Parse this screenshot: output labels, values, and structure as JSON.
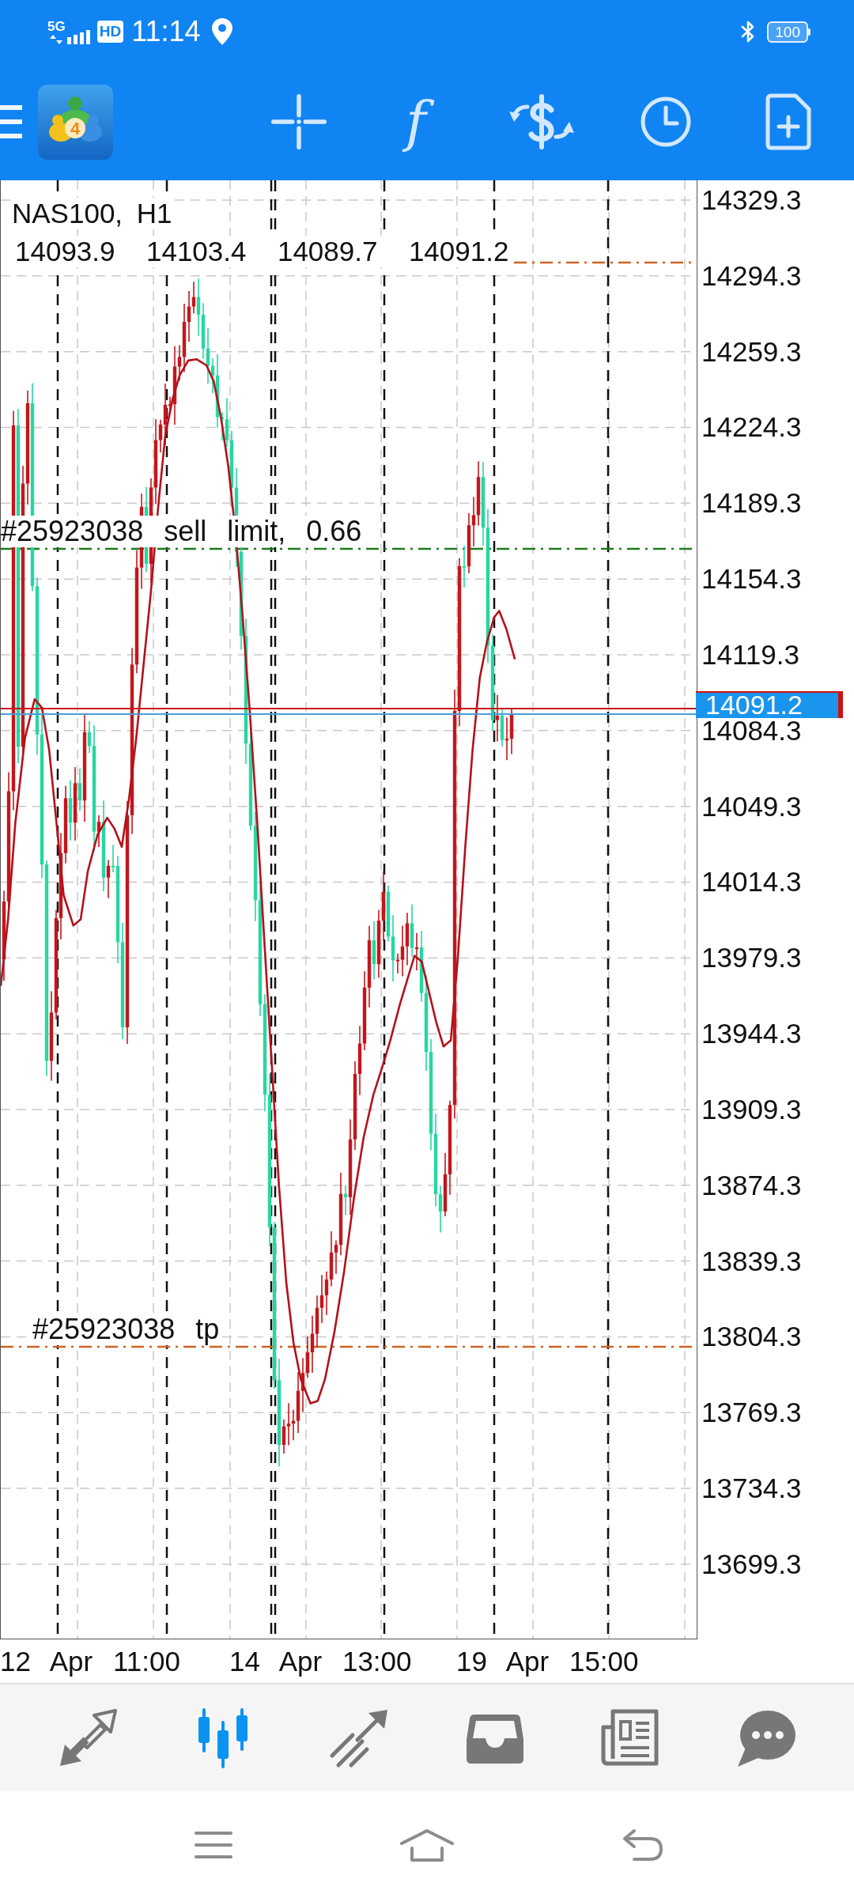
{
  "status_bar": {
    "network": "5G",
    "hd_badge": "HD",
    "time": "11:14",
    "battery": "100"
  },
  "toolbar": {
    "logo_badge": "4",
    "function_glyph": "f"
  },
  "chart": {
    "symbol": "NAS100, H1",
    "ohlc": [
      "14093.9",
      "14103.4",
      "14089.7",
      "14091.2"
    ],
    "orders": [
      {
        "kind": "sl"
      },
      {
        "kind": "entry",
        "label": "#25923038 sell limit, 0.66"
      },
      {
        "kind": "tp",
        "label": "#25923038 tp"
      }
    ],
    "price_ticks": [
      "14329.3",
      "14294.3",
      "14259.3",
      "14224.3",
      "14189.3",
      "14154.3",
      "14119.3",
      "14084.3",
      "14049.3",
      "14014.3",
      "13979.3",
      "13944.3",
      "13909.3",
      "13874.3",
      "13839.3",
      "13804.3",
      "13769.3",
      "13734.3",
      "13699.3"
    ],
    "current_price": "14091.2",
    "time_labels": [
      "12 Apr 11:00",
      "14 Apr 13:00",
      "19 Apr 15:00"
    ]
  },
  "bottom_nav": {
    "items": [
      {
        "selected": false
      },
      {
        "selected": true
      },
      {
        "selected": false
      },
      {
        "selected": false
      },
      {
        "selected": false
      },
      {
        "selected": false
      }
    ]
  }
}
